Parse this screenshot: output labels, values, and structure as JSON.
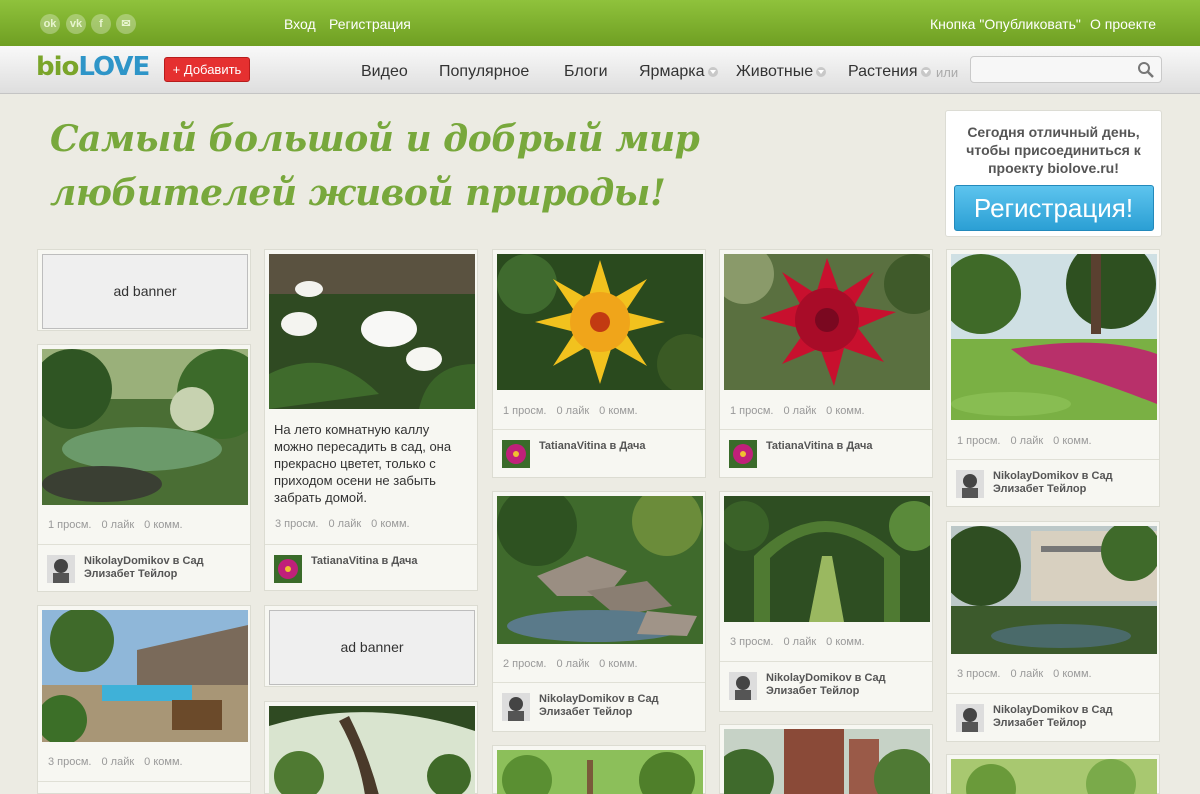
{
  "topbar": {
    "social": [
      "odnoklassniki-icon",
      "vk-icon",
      "facebook-icon",
      "mail-icon"
    ],
    "social_glyphs": [
      "ok",
      "vk",
      "f",
      "✉"
    ],
    "login": "Вход",
    "register": "Регистрация",
    "publish_button": "Кнопка \"Опубликовать\"",
    "about": "О проекте"
  },
  "header": {
    "logo_a": "bio",
    "logo_b": "LOVE",
    "add_button": "+ Добавить",
    "nav": [
      "Видео",
      "Популярное",
      "Блоги",
      "Ярмарка",
      "Животные",
      "Растения"
    ],
    "or_text": "или"
  },
  "hero": {
    "headline_line1": "Самый большой и добрый мир",
    "headline_line2": "любителей живой природы!"
  },
  "join": {
    "text": "Сегодня отличный день, чтобы присоединиться к проекту biolove.ru!",
    "button": "Регистрация!"
  },
  "feed": {
    "ad": "ad banner",
    "calla_desc": "На лето комнатную каллу можно пересадить в сад, она прекрасно цветет, только с приходом осени не забыть забрать домой.",
    "views": {
      "v1": "1 просм.",
      "v2": "2 просм.",
      "v3": "3 просм."
    },
    "likes": "0 лайк",
    "comments": "0 комм.",
    "author_tv": "TatianaVitina в Дача",
    "author_nd": "NikolayDomikov в Сад Элизабет Тейлор"
  },
  "colors": {
    "top_green": "#7aab2c",
    "accent_red": "#e53030",
    "accent_blue": "#2b9fd4",
    "headline": "#78a83c"
  }
}
